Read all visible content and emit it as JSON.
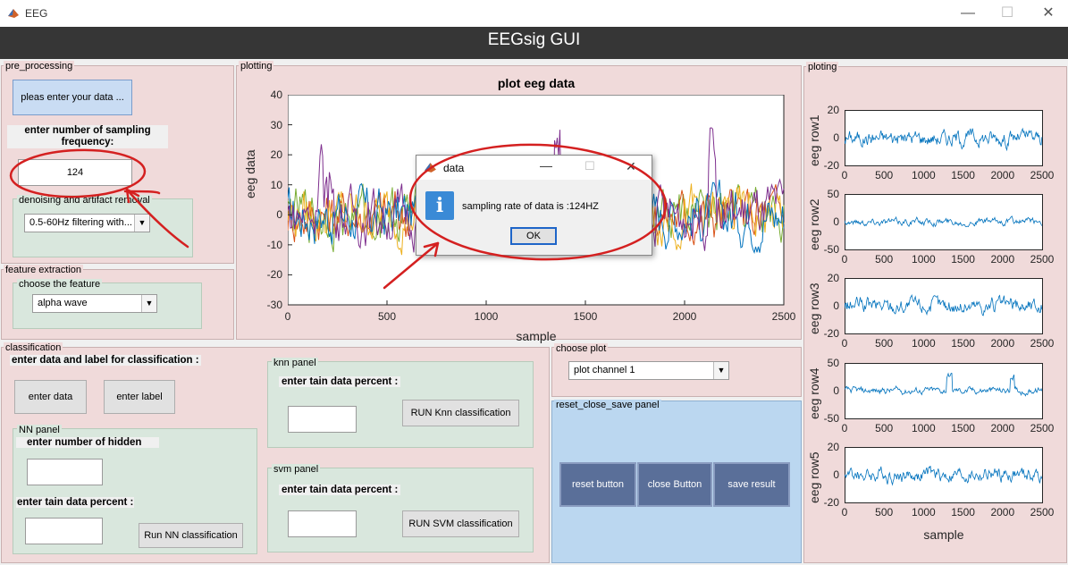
{
  "window": {
    "title": "EEG",
    "minimize": "—",
    "maximize": "☐",
    "close": "✕",
    "header_title": "EEGsig GUI"
  },
  "pre_processing": {
    "title": "pre_processing",
    "enter_data_button": "pleas enter your data ...",
    "sampling_label": "enter number of sampling frequency:",
    "sampling_value": "124",
    "denoise_title": "denoising and artifact removal",
    "denoise_selected": "0.5-60Hz filtering with..."
  },
  "feature_extraction": {
    "title": "feature extraction",
    "choose_title": "choose the feature",
    "selected": "alpha wave"
  },
  "plotting": {
    "title": "plotting",
    "chart_title": "plot eeg data",
    "xlabel": "sample",
    "ylabel": "eeg data",
    "xticks": [
      "0",
      "500",
      "1000",
      "1500",
      "2000",
      "2500"
    ],
    "yticks": [
      "40",
      "30",
      "20",
      "10",
      "0",
      "-10",
      "-20",
      "-30"
    ]
  },
  "classification": {
    "title": "classification",
    "header": "enter data and label for classification :",
    "enter_data_button": "enter data",
    "enter_label_button": "enter label",
    "nn": {
      "title": "NN panel",
      "hidden_label": "enter number of hidden",
      "hidden_value": "",
      "train_label": "enter tain data percent :",
      "train_value": "",
      "run_button": "Run NN classification"
    },
    "knn": {
      "title": "knn panel",
      "train_label": "enter tain data percent :",
      "train_value": "",
      "run_button": "RUN Knn classification"
    },
    "svm": {
      "title": "svm panel",
      "train_label": "enter tain data percent :",
      "train_value": "",
      "run_button": "RUN SVM classification"
    }
  },
  "choose_plot": {
    "title": "choose plot",
    "selected": "plot channel 1"
  },
  "reset_panel": {
    "title": "reset_close_save panel",
    "reset_button": "reset button",
    "close_button": "close Button",
    "save_button": "save result"
  },
  "ploting": {
    "title": "ploting",
    "xlabel": "sample",
    "xticks": [
      "0",
      "500",
      "1000",
      "1500",
      "2000",
      "2500"
    ],
    "rows": [
      {
        "ylabel": "eeg row1",
        "yticks": [
          "20",
          "0",
          "-20"
        ],
        "show_xticks": true
      },
      {
        "ylabel": "eeg row2",
        "yticks": [
          "50",
          "0",
          "-50"
        ],
        "show_xticks": true
      },
      {
        "ylabel": "eeg row3",
        "yticks": [
          "20",
          "0",
          "-20"
        ],
        "show_xticks": true
      },
      {
        "ylabel": "eeg row4",
        "yticks": [
          "50",
          "0",
          "-50"
        ],
        "show_xticks": true
      },
      {
        "ylabel": "eeg row5",
        "yticks": [
          "20",
          "0",
          "-20"
        ],
        "show_xticks": true
      }
    ]
  },
  "dialog": {
    "title": "data",
    "message": "sampling rate of data is :124HZ",
    "ok_button": "OK"
  },
  "colors": {
    "header_bg": "#363636",
    "panel_pink": "#f0dada",
    "panel_green": "#d9e7dd",
    "panel_blue": "#bbd7f0",
    "action_button": "#5a6f99",
    "annotation_red": "#d42020",
    "series": [
      "#0072bd",
      "#d95319",
      "#edb120",
      "#7e2f8e",
      "#77ac30"
    ]
  },
  "icons": {
    "app": "matlab-icon",
    "info": "info-icon",
    "dropdown": "chevron-down-icon"
  }
}
